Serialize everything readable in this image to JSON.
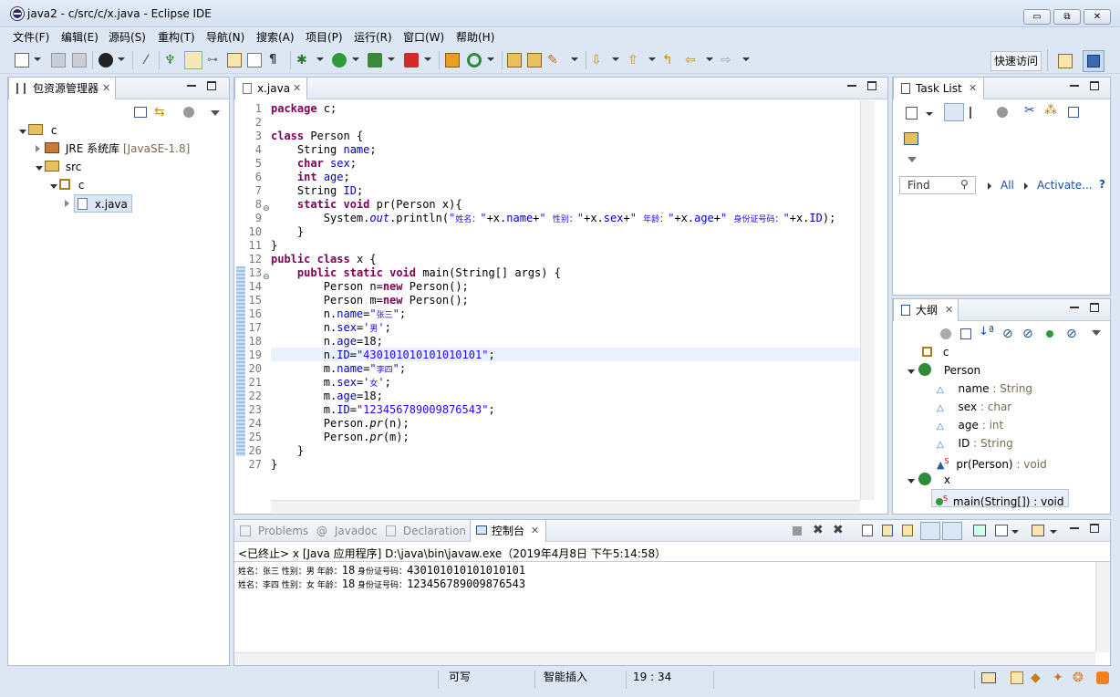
{
  "window": {
    "title": "java2 - c/src/c/x.java - Eclipse IDE",
    "min": "▭",
    "restore": "⧉",
    "close": "✕"
  },
  "menu": [
    "文件(F)",
    "编辑(E)",
    "源码(S)",
    "重构(T)",
    "导航(N)",
    "搜索(A)",
    "项目(P)",
    "运行(R)",
    "窗口(W)",
    "帮助(H)"
  ],
  "toolbar": {
    "quick_access": "快速访问"
  },
  "package_explorer": {
    "tab": "包资源管理器",
    "tree": [
      {
        "label": "c",
        "extra": ""
      },
      {
        "label": "JRE 系统库",
        "extra": "[JavaSE-1.8]"
      },
      {
        "label": "src",
        "extra": ""
      },
      {
        "label": "c",
        "extra": ""
      },
      {
        "label": "x.java",
        "extra": ""
      }
    ]
  },
  "editor": {
    "tab": "x.java",
    "lines": [
      "1",
      "2",
      "3",
      "4",
      "5",
      "6",
      "7",
      "8",
      "9",
      "10",
      "11",
      "12",
      "13",
      "14",
      "15",
      "16",
      "17",
      "18",
      "19",
      "20",
      "21",
      "22",
      "23",
      "24",
      "25",
      "26",
      "27"
    ]
  },
  "task_list": {
    "tab": "Task List",
    "find_placeholder": "Find",
    "all": "All",
    "activate": "Activate...",
    "help": "?"
  },
  "outline": {
    "tab": "大纲",
    "items": [
      {
        "name": "c",
        "type": ""
      },
      {
        "name": "Person",
        "type": ""
      },
      {
        "name": "name",
        "type": " : String"
      },
      {
        "name": "sex",
        "type": " : char"
      },
      {
        "name": "age",
        "type": " : int"
      },
      {
        "name": "ID",
        "type": " : String"
      },
      {
        "name": "pr(Person)",
        "type": " : void"
      },
      {
        "name": "x",
        "type": ""
      },
      {
        "name": "main(String[]) : void",
        "type": ""
      }
    ]
  },
  "bottom": {
    "tabs": [
      "Problems",
      "Javadoc",
      "Declaration",
      "控制台"
    ],
    "status_line": "<已终止> x [Java 应用程序] D:\\java\\bin\\javaw.exe（2019年4月8日 下午5:14:58）",
    "output": [
      {
        "prefix": "姓名：张三 性别：男 年龄：",
        "age": "18",
        "mid": " 身份证号码：",
        "id": "430101010101010101"
      },
      {
        "prefix": "姓名：李四 性别：女 年龄：",
        "age": "18",
        "mid": " 身份证号码：",
        "id": "123456789009876543"
      }
    ]
  },
  "statusbar": {
    "writable": "可写",
    "insert": "智能插入",
    "position": "19 : 34"
  },
  "colors": {
    "keyword": "#7f0055",
    "field": "#0000c0",
    "string": "#2a00ff",
    "highlight_line": "#e8f2fe"
  }
}
